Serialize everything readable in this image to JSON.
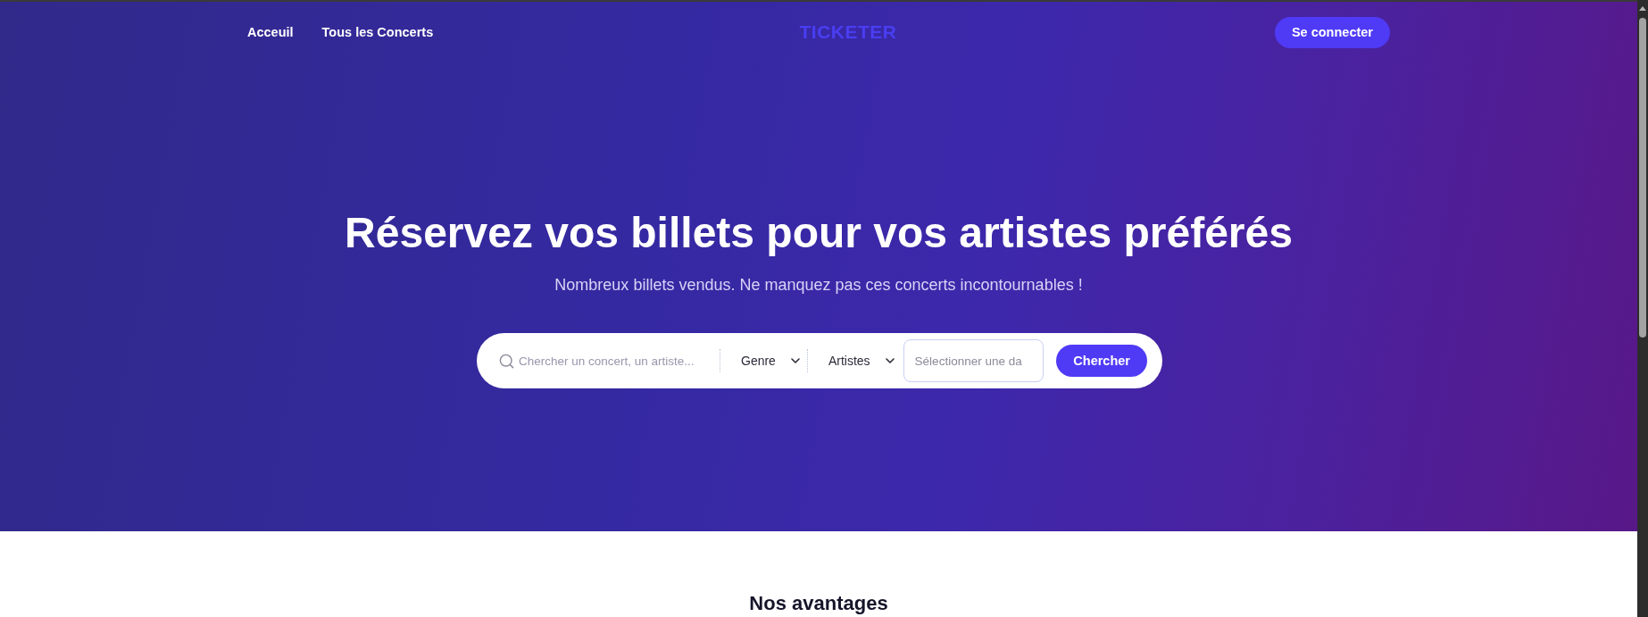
{
  "nav": {
    "links": [
      {
        "label": "Acceuil"
      },
      {
        "label": "Tous les Concerts"
      }
    ],
    "logo": "TICKETER",
    "login_button": "Se connecter"
  },
  "hero": {
    "title": "Réservez vos billets pour vos artistes préférés",
    "subtitle": "Nombreux billets vendus. Ne manquez pas ces concerts incontournables !",
    "search": {
      "query": {
        "placeholder": "Chercher un concert, un artiste..."
      },
      "filters": [
        {
          "label": "Genre"
        },
        {
          "label": "Artistes"
        }
      ],
      "date": {
        "placeholder": "Sélectionner une da"
      },
      "button": "Chercher"
    }
  },
  "section": {
    "title": "Nos avantages"
  }
}
